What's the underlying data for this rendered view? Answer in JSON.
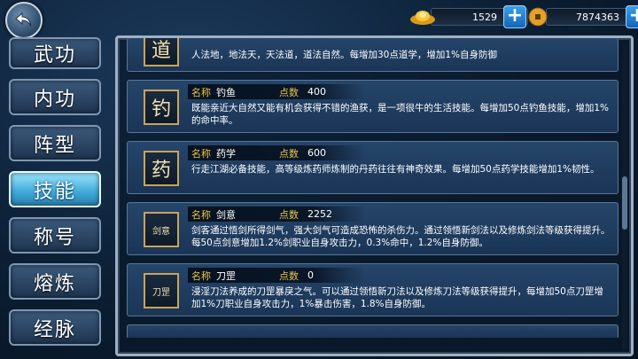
{
  "currency": {
    "ingots": "1529",
    "coins": "7874363"
  },
  "tabs": [
    "武功",
    "内功",
    "阵型",
    "技能",
    "称号",
    "熔炼",
    "经脉"
  ],
  "active_tab": "技能",
  "labels": {
    "name": "名称",
    "points": "点数"
  },
  "top_partial": {
    "icon_text": "道",
    "desc": "人法地，地法天，天法道，道法自然。每增加30点道学，增加1%自身防御"
  },
  "skills": [
    {
      "icon_text": "钓",
      "name": "钓鱼",
      "points": "400",
      "desc": "既能亲近大自然又能有机会获得不错的渔获，是一项很牛的生活技能。每增加50点钓鱼技能，增加1%的命中率。"
    },
    {
      "icon_text": "药",
      "name": "药学",
      "points": "600",
      "desc": "行走江湖必备技能，高等级炼药师炼制的丹药往往有神奇效果。每增加50点药学技能增加1%韧性。"
    },
    {
      "icon_text": "剑意",
      "name": "剑意",
      "points": "2252",
      "desc": "剑客通过悟剑所得剑气，强大剑气可造成恐怖的杀伤力。通过领悟新剑法以及修炼剑法等级获得提升。每50点剑意增加1.2%剑职业自身攻击力，0.3%命中，1.2%自身防御。"
    },
    {
      "icon_text": "刀罡",
      "name": "刀罡",
      "points": "0",
      "desc": "浸淫刀法养成的刀罡暴戾之气。可以通过领悟新刀法以及修炼刀法等级获得提升，每增加50点刀罡增加1%刀职业自身攻击力，1%暴击伤害，1.8%自身防御。"
    }
  ]
}
